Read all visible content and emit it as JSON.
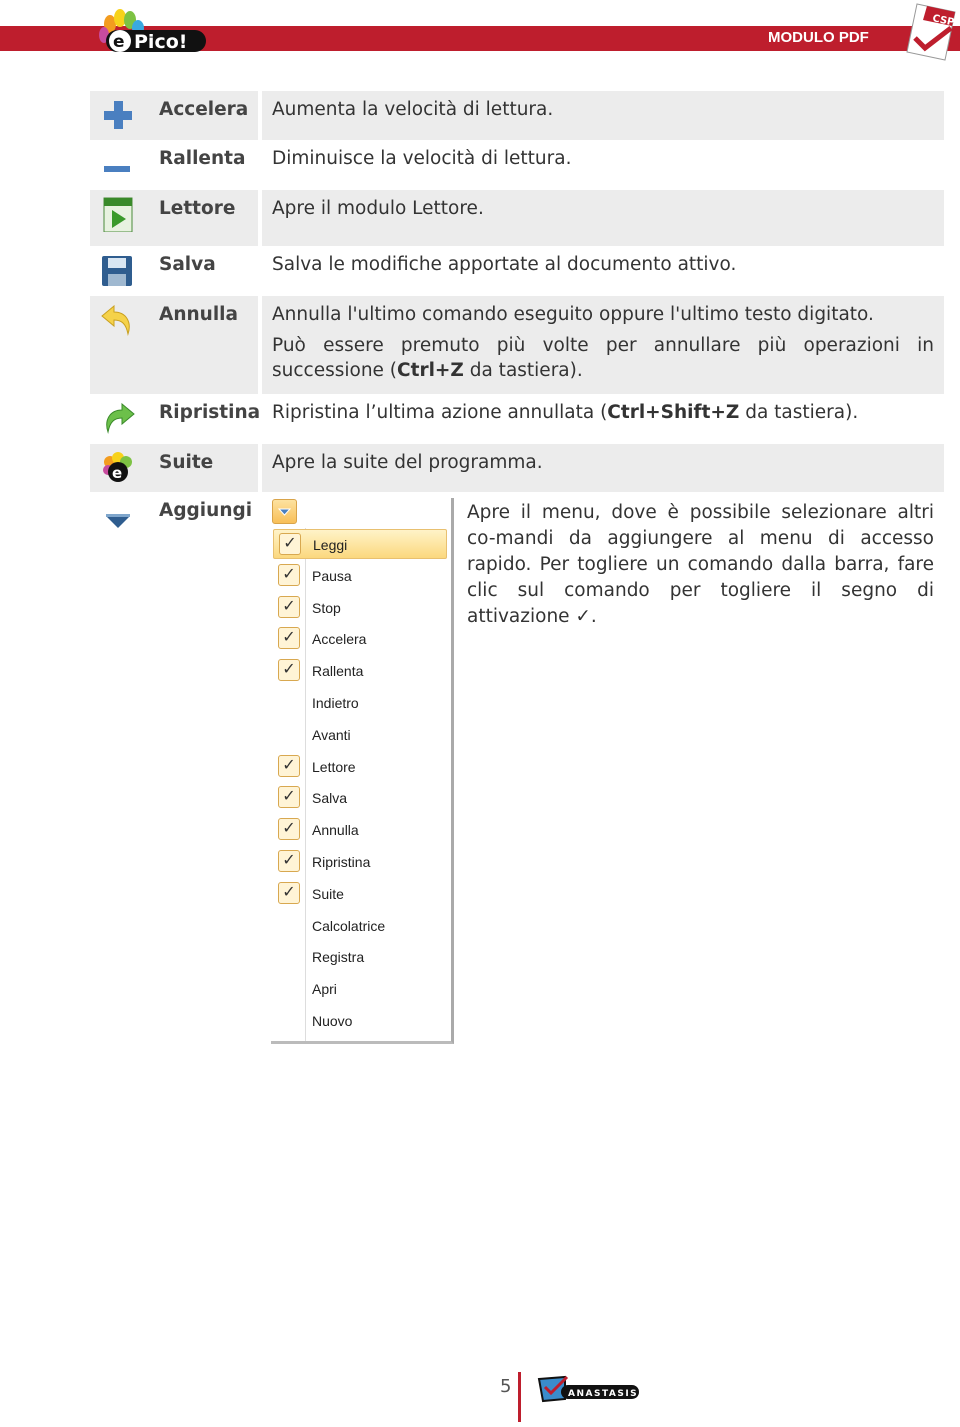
{
  "header": {
    "title": "MODULO PDF",
    "logo_text": "ePico!",
    "badge_text": "CSP"
  },
  "rows": [
    {
      "icon": "plus-icon",
      "label": "Accelera",
      "desc": "Aumenta la velocità di lettura."
    },
    {
      "icon": "minus-icon",
      "label": "Rallenta",
      "desc": "Diminuisce la velocità di lettura."
    },
    {
      "icon": "play-icon",
      "label": "Lettore",
      "desc": "Apre il modulo Lettore."
    },
    {
      "icon": "floppy-save-icon",
      "label": "Salva",
      "desc": "Salva le modifiche apportate al documento attivo."
    },
    {
      "icon": "undo-arrow-icon",
      "label": "Annulla",
      "desc": "Annulla l'ultimo comando eseguito oppure l'ultimo testo digitato.",
      "desc2": "Può essere premuto più volte per annullare più operazioni in successione (",
      "desc2_bold": "Ctrl+Z",
      "desc2_end": " da tastiera)."
    },
    {
      "icon": "redo-arrow-icon",
      "label": "Ripristina",
      "desc": "Ripristina l’ultima azione annullata (",
      "desc_bold": "Ctrl+Shift+Z",
      "desc_end": " da tastiera)."
    },
    {
      "icon": "epico-suite-icon",
      "label": "Suite",
      "desc": "Apre la suite del programma."
    },
    {
      "icon": "dropdown-arrow-icon",
      "label": "Aggiungi",
      "desc": "Apre il menu, dove è possibile selezionare altri co-mandi da aggiungere al menu di accesso rapido. Per togliere un comando dalla barra, fare clic sul comando per togliere il segno di attivazione ✓."
    }
  ],
  "menu": {
    "items": [
      {
        "label": "Leggi",
        "checked": true,
        "highlighted": true
      },
      {
        "label": "Pausa",
        "checked": true
      },
      {
        "label": "Stop",
        "checked": true
      },
      {
        "label": "Accelera",
        "checked": true
      },
      {
        "label": "Rallenta",
        "checked": true
      },
      {
        "label": "Indietro",
        "checked": false
      },
      {
        "label": "Avanti",
        "checked": false
      },
      {
        "label": "Lettore",
        "checked": true
      },
      {
        "label": "Salva",
        "checked": true
      },
      {
        "label": "Annulla",
        "checked": true
      },
      {
        "label": "Ripristina",
        "checked": true
      },
      {
        "label": "Suite",
        "checked": true
      },
      {
        "label": "Calcolatrice",
        "checked": false
      },
      {
        "label": "Registra",
        "checked": false
      },
      {
        "label": "Apri",
        "checked": false
      },
      {
        "label": "Nuovo",
        "checked": false
      }
    ]
  },
  "footer": {
    "page": "5",
    "publisher": "ANASTASIS"
  },
  "colors": {
    "brand_red": "#be1e2d",
    "row_gray": "#ececec",
    "menu_highlight": "#fbd87e"
  }
}
